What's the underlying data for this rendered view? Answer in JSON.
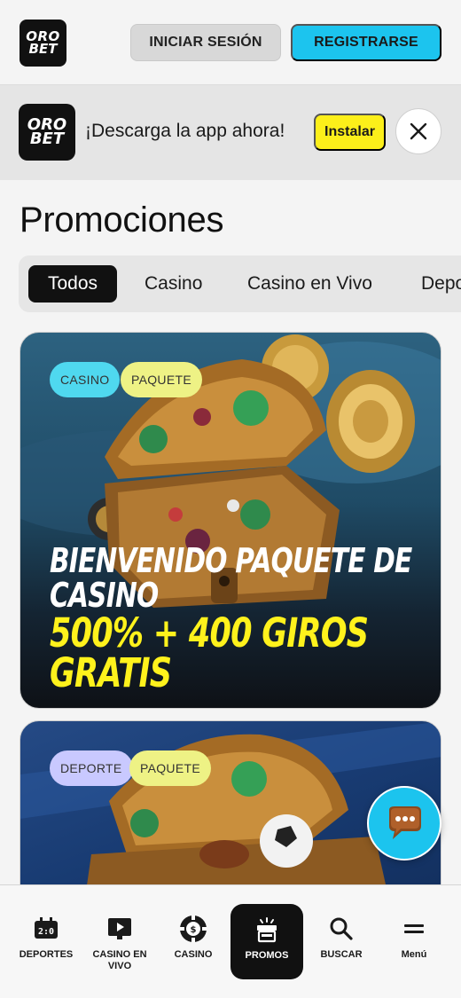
{
  "header": {
    "logo_line1": "ORO",
    "logo_line2": "BET",
    "login_label": "INICIAR SESIÓN",
    "register_label": "REGISTRARSE"
  },
  "app_banner": {
    "logo_line1": "ORO",
    "logo_line2": "BET",
    "text": "¡Descarga la app ahora!",
    "install_label": "Instalar"
  },
  "page_title": "Promociones",
  "filters": [
    "Todos",
    "Casino",
    "Casino en Vivo",
    "Deportes"
  ],
  "cards": [
    {
      "tags": [
        "CASINO",
        "PAQUETE"
      ],
      "title_white": [
        "BIENVENIDO PAQUETE DE",
        "CASINO"
      ],
      "title_yellow": [
        "500% + 400 GIROS",
        "GRATIS"
      ]
    },
    {
      "tags": [
        "DEPORTE",
        "PAQUETE"
      ]
    }
  ],
  "bottom_nav": [
    {
      "label": "DEPORTES",
      "icon": "scoreboard-icon"
    },
    {
      "label": "CASINO EN VIVO",
      "icon": "live-play-icon"
    },
    {
      "label": "CASINO",
      "icon": "casino-chip-icon"
    },
    {
      "label": "PROMOS",
      "icon": "gift-icon"
    },
    {
      "label": "BUSCAR",
      "icon": "search-icon"
    },
    {
      "label": "Menú",
      "icon": "menu-icon"
    }
  ],
  "colors": {
    "accent_cyan": "#1cc4ee",
    "accent_yellow": "#fcef1a",
    "tag_casino": "#4fd8ef",
    "tag_paquete": "#eef285",
    "tag_deporte": "#c9c9ff"
  }
}
